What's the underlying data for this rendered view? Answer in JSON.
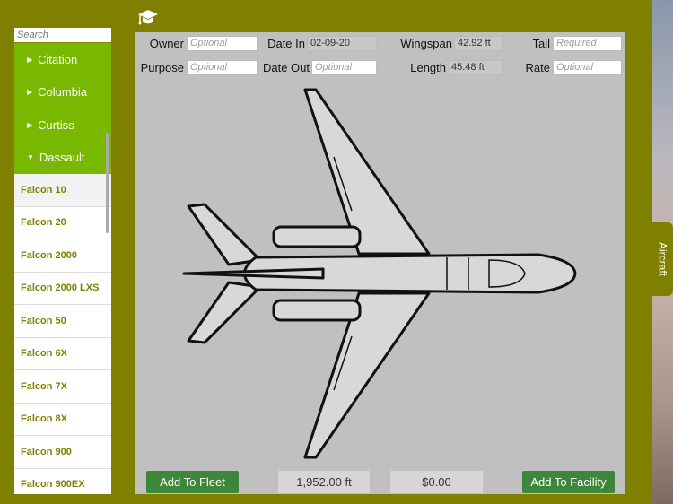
{
  "sidebar": {
    "search_placeholder": "Search",
    "groups": [
      {
        "label": "Citation"
      },
      {
        "label": "Columbia"
      },
      {
        "label": "Curtiss"
      },
      {
        "label": "Dassault",
        "expanded": true
      }
    ],
    "items": [
      "Falcon 10",
      "Falcon 20",
      "Falcon 2000",
      "Falcon 2000 LXS",
      "Falcon 50",
      "Falcon 6X",
      "Falcon 7X",
      "Falcon 8X",
      "Falcon 900",
      "Falcon 900EX"
    ]
  },
  "form": {
    "owner_label": "Owner",
    "owner_placeholder": "Optional",
    "purpose_label": "Purpose",
    "purpose_placeholder": "Optional",
    "date_in_label": "Date In",
    "date_in_value": "02-09-20",
    "date_out_label": "Date Out",
    "date_out_placeholder": "Optional",
    "wingspan_label": "Wingspan",
    "wingspan_value": "42.92 ft",
    "length_label": "Length",
    "length_value": "45.48 ft",
    "tail_label": "Tail",
    "tail_placeholder": "Required",
    "rate_label": "Rate",
    "rate_placeholder": "Optional"
  },
  "footer": {
    "add_fleet": "Add To Fleet",
    "area": "1,952.00 ft",
    "cost": "$0.00",
    "add_facility": "Add To Facility"
  },
  "side_tab": "Aircraft",
  "colors": {
    "olive": "#808000",
    "green": "#78b800",
    "button": "#3c873a"
  }
}
